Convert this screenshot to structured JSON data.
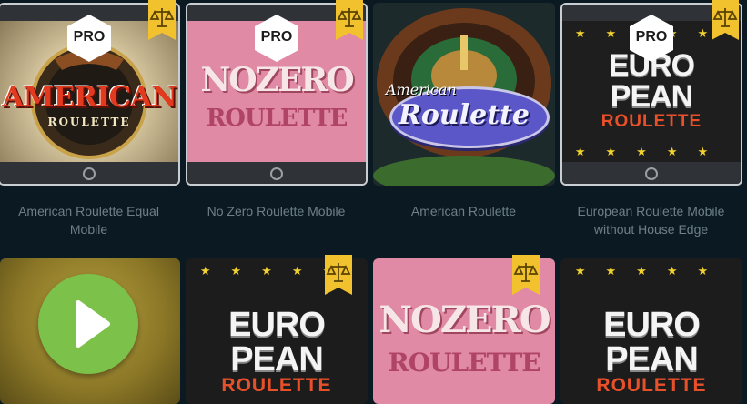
{
  "games": [
    {
      "title": "American Roulette Equal Mobile",
      "pro": "PRO",
      "art_line1": "AMERICAN",
      "art_line2": "ROULETTE"
    },
    {
      "title": "No Zero Roulette Mobile",
      "pro": "PRO",
      "art_line1": "NOZERO",
      "art_line2": "ROULETTE"
    },
    {
      "title": "American Roulette",
      "art_line1": "American",
      "art_line2": "Roulette"
    },
    {
      "title": "European Roulette Mobile without House Edge",
      "pro": "PRO",
      "art_line1": "EURO",
      "art_line2": "PEAN",
      "art_line3": "ROULETTE"
    }
  ],
  "row2": [
    {
      "icon": "play-icon"
    },
    {
      "art_line1": "EURO",
      "art_line2": "PEAN",
      "art_line3": "ROULETTE"
    },
    {
      "art_line1": "NOZERO",
      "art_line2": "ROULETTE"
    },
    {
      "art_line1": "EURO",
      "art_line2": "PEAN",
      "art_line3": "ROULETTE"
    }
  ],
  "colors": {
    "background": "#0b1a22",
    "badge": "#f2c12e",
    "caption": "#6f7f88",
    "play": "#7cc14a"
  }
}
